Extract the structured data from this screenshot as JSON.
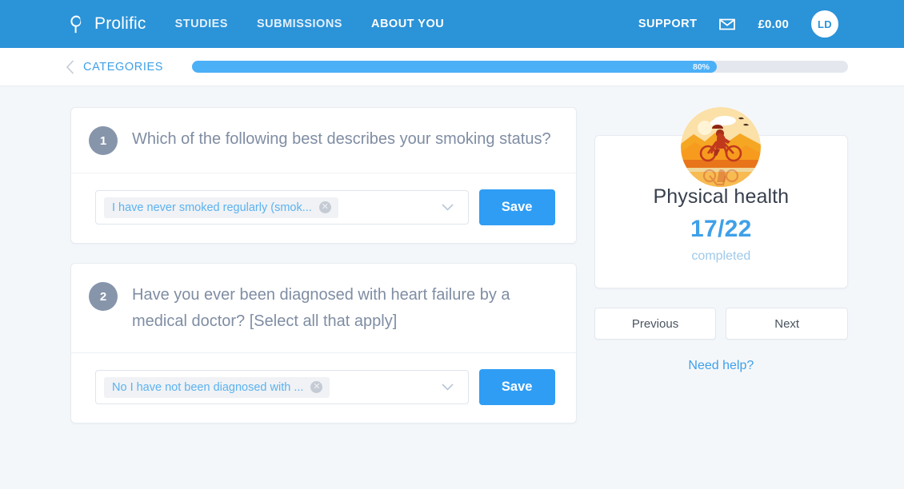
{
  "header": {
    "brand_name": "Prolific",
    "brand_icon": "prolific-logo-icon",
    "nav": [
      {
        "label": "STUDIES",
        "active": false
      },
      {
        "label": "SUBMISSIONS",
        "active": false
      },
      {
        "label": "ABOUT YOU",
        "active": true
      }
    ],
    "support_label": "SUPPORT",
    "mail_icon": "envelope-icon",
    "balance": "£0.00",
    "avatar_initials": "LD",
    "bg_color": "#2b93d8"
  },
  "subheader": {
    "back_icon": "chevron-left-icon",
    "back_label": "CATEGORIES",
    "progress": {
      "label": "80%",
      "percent": 80,
      "fill_color": "#4cb0f7",
      "track_color": "#e4e8ee"
    }
  },
  "questions": [
    {
      "number": "1",
      "text": "Which of the following best describes your smoking status?",
      "answer_chip": "I have never smoked regularly (smok...",
      "remove_icon": "close-circle-icon",
      "caret_icon": "chevron-down-icon",
      "save_label": "Save"
    },
    {
      "number": "2",
      "text": "Have you ever been diagnosed with heart failure by a medical doctor? [Select all that apply]",
      "answer_chip": "No I have not been diagnosed with ...",
      "remove_icon": "close-circle-icon",
      "caret_icon": "chevron-down-icon",
      "save_label": "Save"
    }
  ],
  "sidebar": {
    "illustration_icon": "cyclist-illustration-icon",
    "category_title": "Physical health",
    "completed_count": "17/22",
    "completed_label": "completed",
    "previous_label": "Previous",
    "next_label": "Next",
    "help_label": "Need help?",
    "accent_color": "#3fa0e8"
  }
}
